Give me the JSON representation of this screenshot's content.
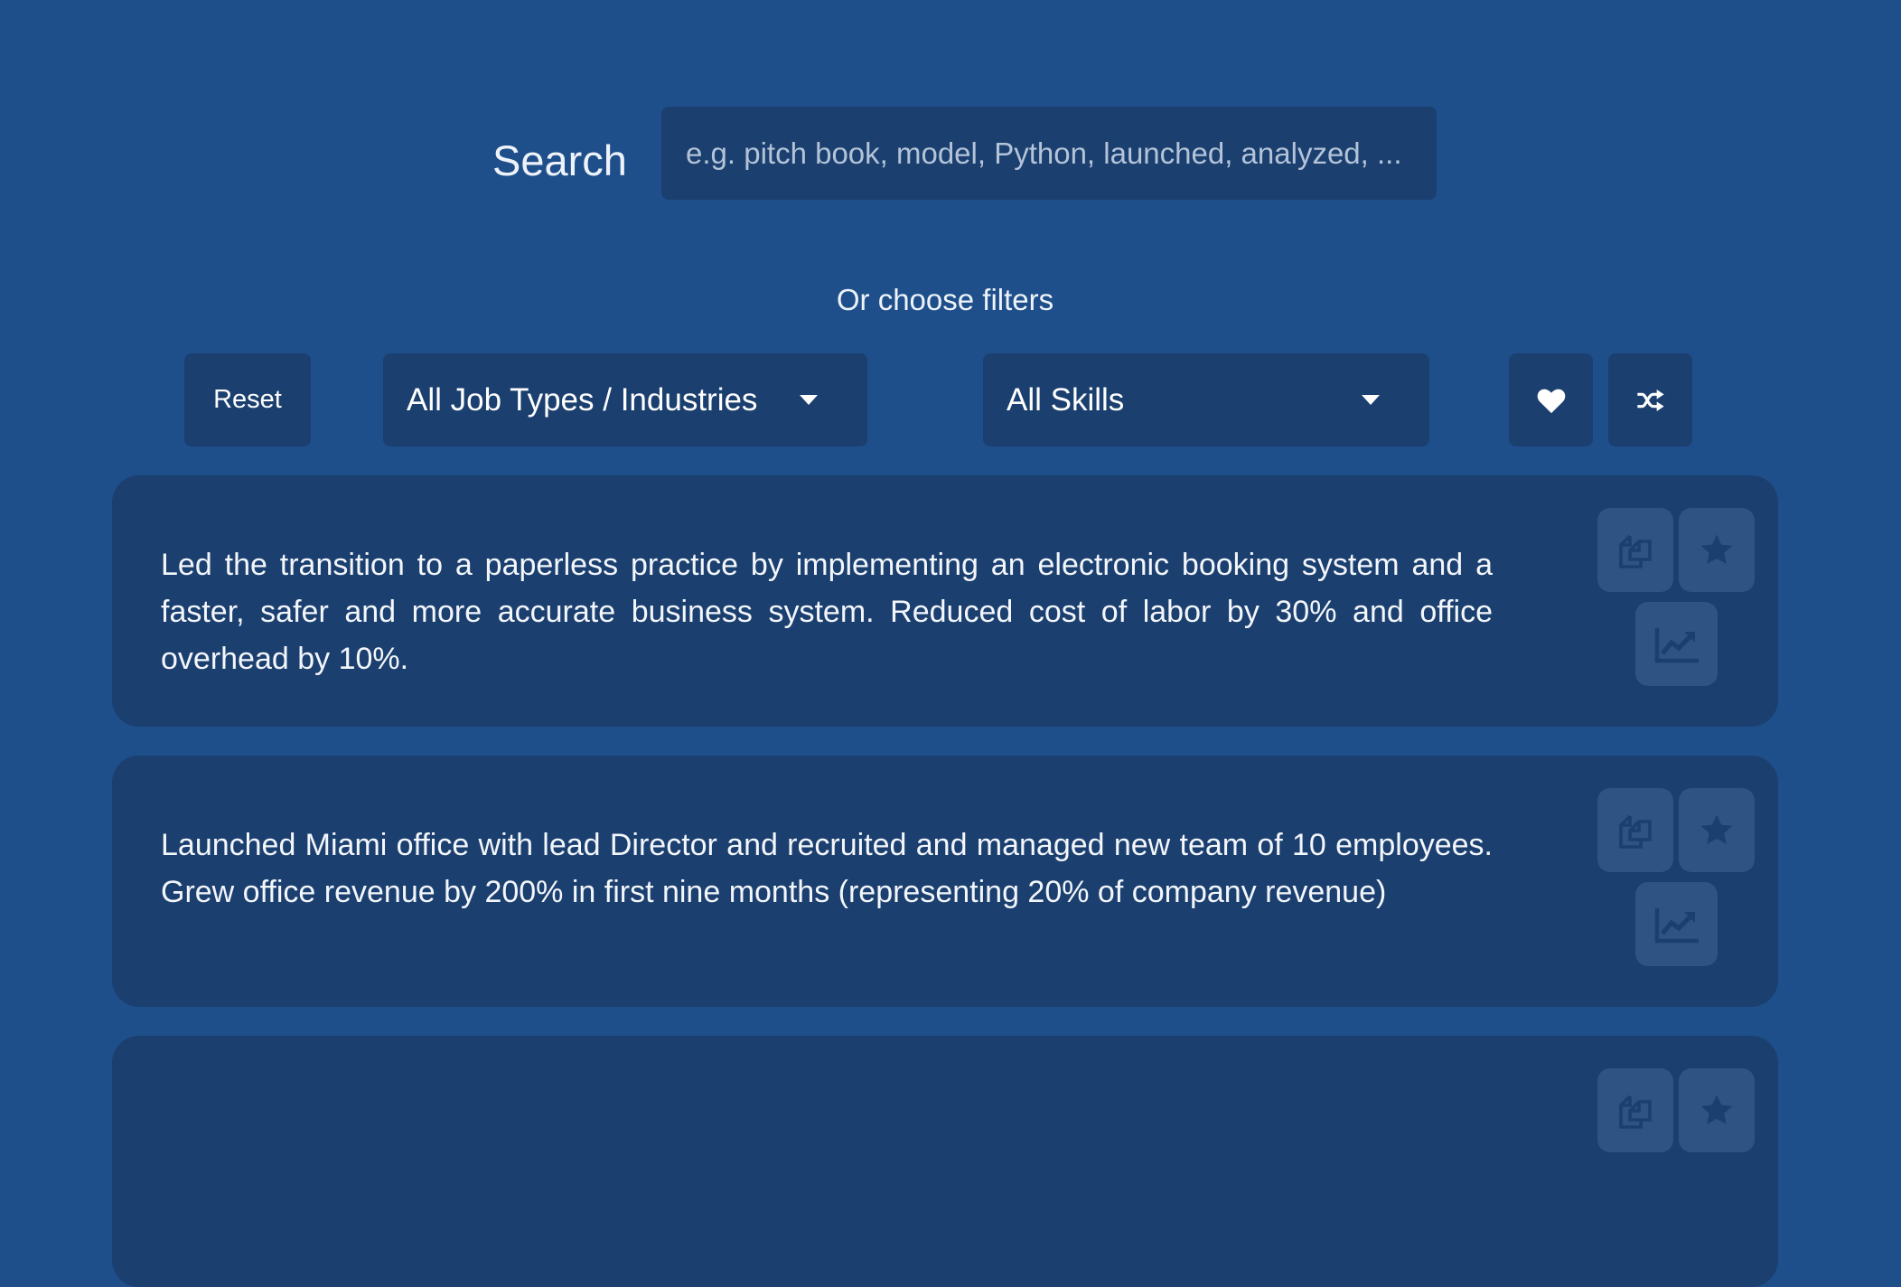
{
  "search": {
    "label": "Search",
    "placeholder": "e.g. pitch book, model, Python, launched, analyzed, ...",
    "value": ""
  },
  "filters": {
    "heading": "Or choose filters",
    "reset_label": "Reset",
    "job_type_selected": "All Job Types / Industries",
    "skills_selected": "All Skills",
    "favorites_icon": "heart-icon",
    "shuffle_icon": "shuffle-icon"
  },
  "results": [
    {
      "text": "Led the transition to a paperless practice by implementing an electronic booking system and a faster, safer and more accurate business system. Reduced cost of labor by 30% and office overhead by 10%.",
      "actions": [
        "copy-icon",
        "star-icon",
        "chart-icon"
      ]
    },
    {
      "text": "Launched Miami office with lead Director and recruited and managed new team of 10 employees. Grew office revenue by 200% in first nine months (representing 20% of company revenue)",
      "actions": [
        "copy-icon",
        "star-icon",
        "chart-icon"
      ]
    },
    {
      "text": "",
      "actions": [
        "copy-icon",
        "star-icon"
      ]
    }
  ],
  "colors": {
    "background": "#1e4f8a",
    "panel": "#1b3f6f",
    "action_button": "#2f5383",
    "action_icon": "#1b3f6f"
  }
}
